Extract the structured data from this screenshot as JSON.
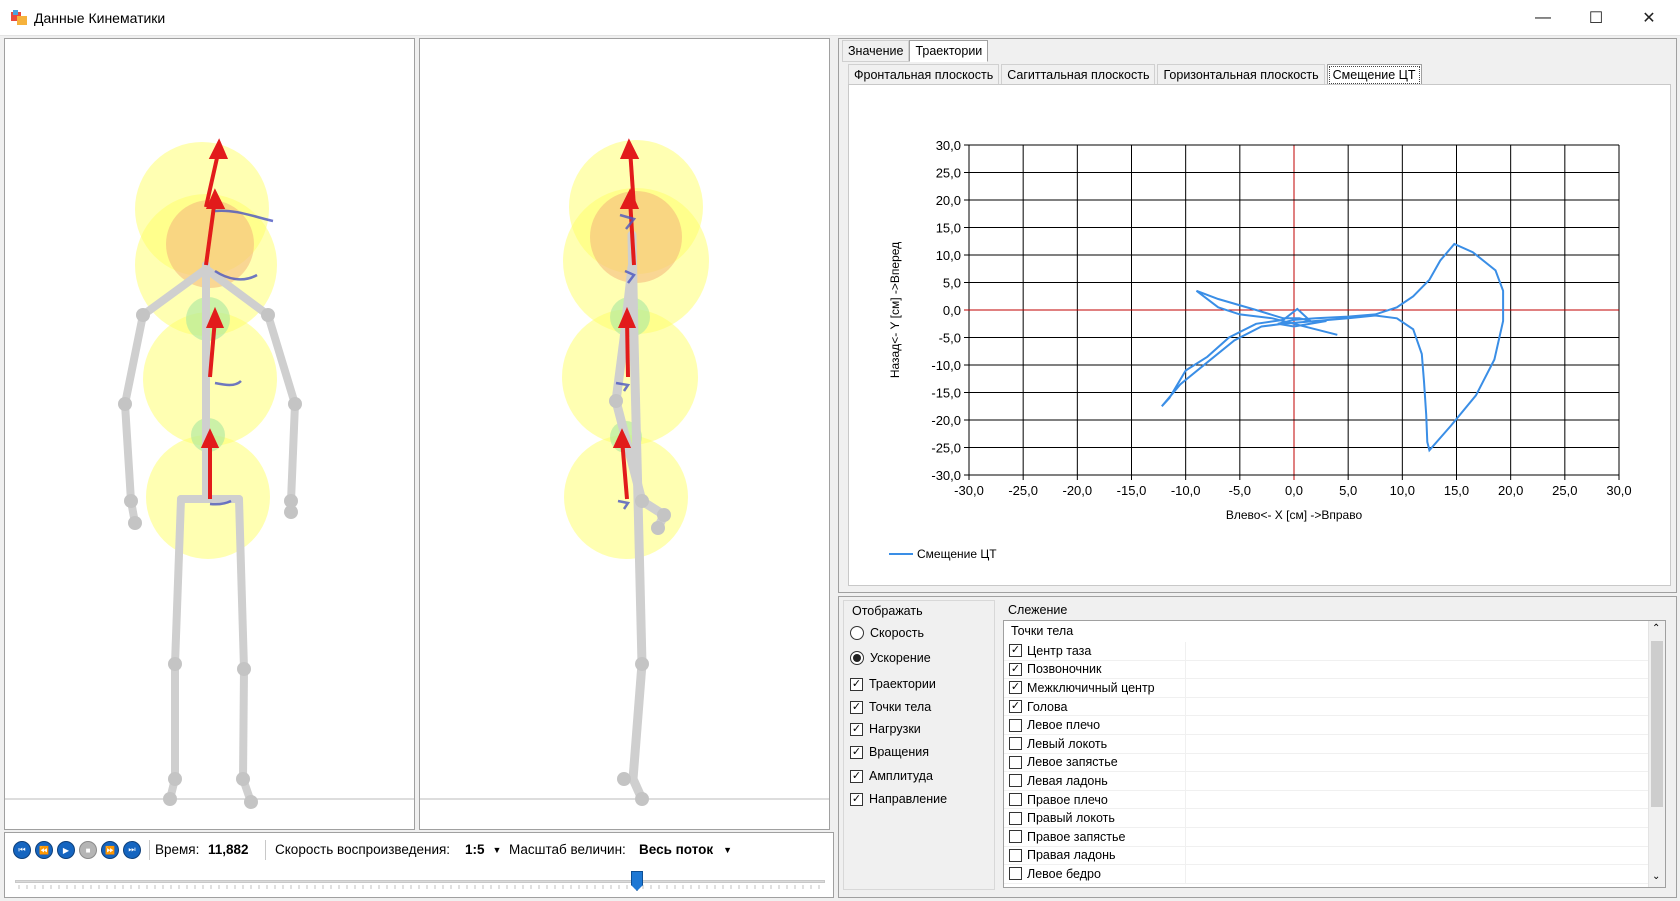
{
  "window": {
    "title": "Данные Кинематики",
    "min_glyph": "—",
    "max_glyph": "☐",
    "close_glyph": "✕"
  },
  "playback": {
    "time_label": "Время:",
    "time_value": "11,882",
    "speed_label": "Скорость воспроизведения:",
    "speed_value": "1:5",
    "scale_label": "Масштаб величин:",
    "scale_value": "Весь поток",
    "slider_position": 0.77
  },
  "tabs": {
    "main": [
      "Значение",
      "Траектории"
    ],
    "main_active": 1,
    "sub": [
      "Фронтальная плоскость",
      "Сагиттальная плоскость",
      "Горизонтальная плоскость",
      "Смещение ЦТ"
    ],
    "sub_active": 3
  },
  "colors": {
    "grid": "#000000",
    "axis_zero": "#c00000",
    "series": "#3a8ee6",
    "selection": "#1565c0"
  },
  "chart_data": {
    "type": "line",
    "title": "",
    "xlabel": "Влево<- X [см] ->Вправо",
    "ylabel": "Назад<- Y [см] ->Вперед",
    "xlim": [
      -30,
      30
    ],
    "ylim": [
      -30,
      30
    ],
    "x_ticks": [
      "-30,0",
      "-25,0",
      "-20,0",
      "-15,0",
      "-10,0",
      "-5,0",
      "0,0",
      "5,0",
      "10,0",
      "15,0",
      "20,0",
      "25,0",
      "30,0"
    ],
    "y_ticks": [
      "30,0",
      "25,0",
      "20,0",
      "15,0",
      "10,0",
      "5,0",
      "0,0",
      "-5,0",
      "-10,0",
      "-15,0",
      "-20,0",
      "-25,0",
      "-30,0"
    ],
    "grid": true,
    "legend_position": "bottom-left",
    "series": [
      {
        "name": "Смещение ЦТ",
        "points": [
          [
            4,
            -4.5
          ],
          [
            2,
            -3.5
          ],
          [
            0,
            -2.5
          ],
          [
            -2,
            -1.5
          ],
          [
            -5,
            -0.8
          ],
          [
            -7,
            0.5
          ],
          [
            -9,
            3.5
          ],
          [
            -7,
            2
          ],
          [
            -3.5,
            0
          ],
          [
            -1,
            -1.5
          ],
          [
            0.5,
            -1.5
          ],
          [
            1.5,
            -2
          ],
          [
            0.3,
            0.2
          ],
          [
            -1,
            -1.8
          ],
          [
            -3.5,
            -2.5
          ],
          [
            -6,
            -5
          ],
          [
            -8,
            -8.5
          ],
          [
            -10,
            -11
          ],
          [
            -11.5,
            -16
          ],
          [
            -12.2,
            -17.5
          ],
          [
            -10.5,
            -13.5
          ],
          [
            -8,
            -9.5
          ],
          [
            -5.5,
            -5.5
          ],
          [
            -3,
            -3
          ],
          [
            -1,
            -2.5
          ],
          [
            2,
            -2
          ],
          [
            5,
            -1.5
          ],
          [
            7.5,
            -1
          ],
          [
            9.5,
            -1.5
          ],
          [
            11,
            -3.5
          ],
          [
            11.8,
            -8
          ],
          [
            12,
            -13
          ],
          [
            12.2,
            -19
          ],
          [
            12.3,
            -24
          ],
          [
            12.5,
            -25.5
          ],
          [
            14.5,
            -21
          ],
          [
            16.8,
            -15.5
          ],
          [
            18.5,
            -9
          ],
          [
            19.3,
            -2
          ],
          [
            19.3,
            3.5
          ],
          [
            18.6,
            7.2
          ],
          [
            16.5,
            10.5
          ],
          [
            14.8,
            12
          ],
          [
            13.5,
            9
          ],
          [
            12.5,
            5.5
          ],
          [
            11,
            2.5
          ],
          [
            9.5,
            0.5
          ],
          [
            7.5,
            -0.8
          ],
          [
            5,
            -1.2
          ],
          [
            2,
            -1.5
          ],
          [
            0,
            -1.8
          ],
          [
            -1.5,
            -2.5
          ],
          [
            0,
            -3
          ],
          [
            3,
            -2
          ]
        ]
      }
    ]
  },
  "display": {
    "title": "Отображать",
    "radios": [
      {
        "label": "Скорость",
        "on": false
      },
      {
        "label": "Ускорение",
        "on": true
      }
    ],
    "checks": [
      {
        "label": "Траектории",
        "on": true
      },
      {
        "label": "Точки тела",
        "on": true
      },
      {
        "label": "Нагрузки",
        "on": true
      },
      {
        "label": "Вращения",
        "on": true
      },
      {
        "label": "Амплитуда",
        "on": true
      },
      {
        "label": "Направление",
        "on": true
      }
    ]
  },
  "tracking": {
    "title": "Слежение",
    "header": "Точки тела",
    "items": [
      {
        "label": "Центр таза",
        "on": true
      },
      {
        "label": "Позвоночник",
        "on": true
      },
      {
        "label": "Межключичный центр",
        "on": true
      },
      {
        "label": "Голова",
        "on": true
      },
      {
        "label": "Левое плечо",
        "on": false
      },
      {
        "label": "Левый локоть",
        "on": false
      },
      {
        "label": "Левое запястье",
        "on": false
      },
      {
        "label": "Левая ладонь",
        "on": false
      },
      {
        "label": "Правое плечо",
        "on": false
      },
      {
        "label": "Правый локоть",
        "on": false
      },
      {
        "label": "Правое запястье",
        "on": false
      },
      {
        "label": "Правая ладонь",
        "on": false
      },
      {
        "label": "Левое бедро",
        "on": false
      }
    ]
  }
}
